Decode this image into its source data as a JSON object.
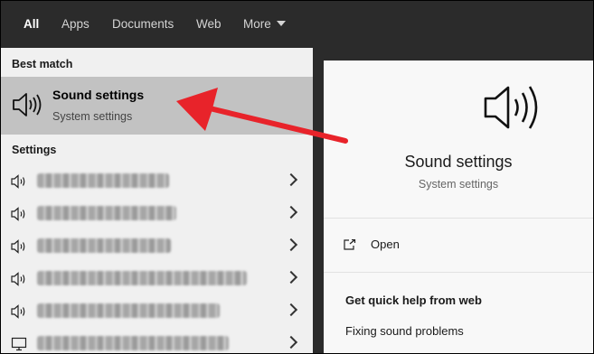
{
  "nav": {
    "tabs": [
      {
        "label": "All"
      },
      {
        "label": "Apps"
      },
      {
        "label": "Documents"
      },
      {
        "label": "Web"
      },
      {
        "label": "More"
      }
    ]
  },
  "left": {
    "best_match_header": "Best match",
    "best_match": {
      "title": "Sound settings",
      "subtitle": "System settings",
      "icon": "speaker-icon"
    },
    "settings_header": "Settings"
  },
  "right": {
    "title": "Sound settings",
    "subtitle": "System settings",
    "open_label": "Open",
    "quick_help_header": "Get quick help from web",
    "quick_help_items": [
      "Fixing sound problems"
    ]
  },
  "colors": {
    "accent_arrow": "#e8232a",
    "selected_row": "#c2c2c2",
    "topbar": "#2b2b2b"
  }
}
